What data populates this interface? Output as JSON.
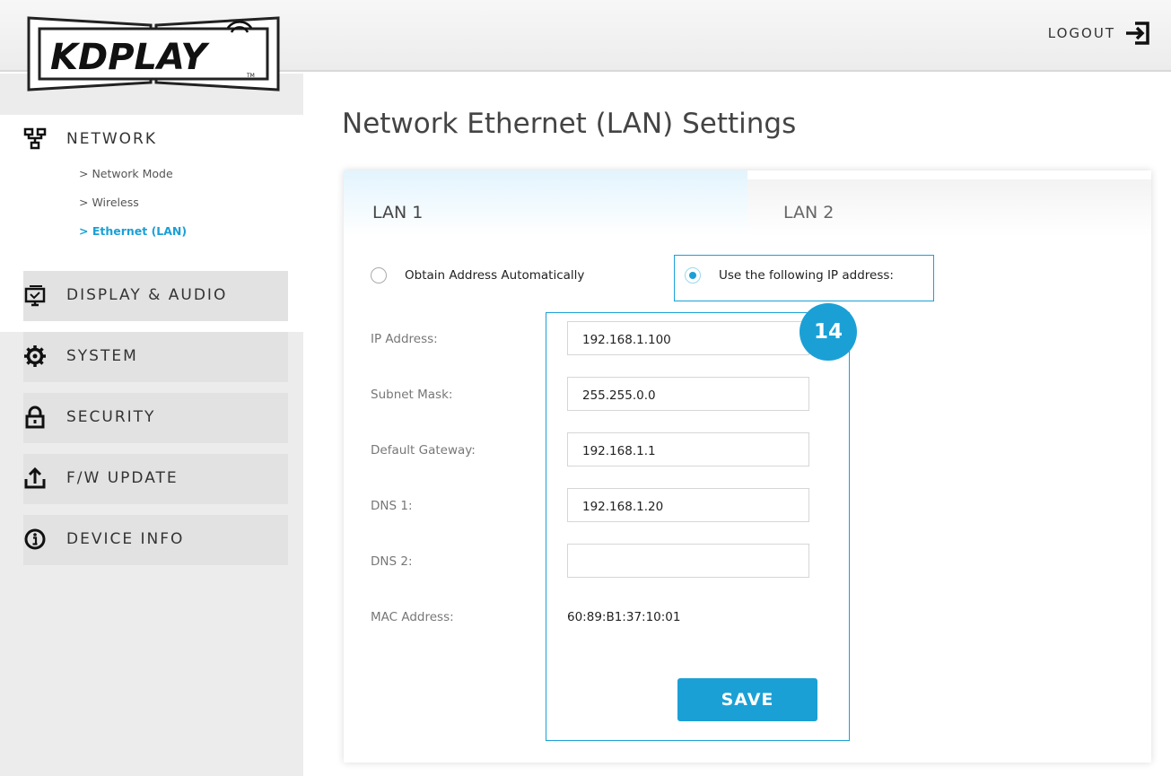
{
  "logo": {
    "text": "KDPLAY",
    "tm": "TM"
  },
  "header": {
    "logout_label": "LOGOUT"
  },
  "sidebar": {
    "network": {
      "label": "NETWORK",
      "sub_items": [
        {
          "label": "> Network Mode"
        },
        {
          "label": "> Wireless"
        },
        {
          "label": "> Ethernet (LAN)"
        }
      ]
    },
    "items": [
      {
        "label": "DISPLAY & AUDIO"
      },
      {
        "label": "SYSTEM"
      },
      {
        "label": "SECURITY"
      },
      {
        "label": "F/W UPDATE"
      },
      {
        "label": "DEVICE INFO"
      }
    ]
  },
  "main": {
    "title": "Network Ethernet (LAN) Settings",
    "tabs": [
      {
        "label": "LAN 1"
      },
      {
        "label": "LAN 2"
      }
    ],
    "mode": {
      "auto_label": "Obtain Address Automatically",
      "manual_label": "Use the following IP address:"
    },
    "fields": {
      "ip": {
        "label": "IP Address:",
        "value": "192.168.1.100"
      },
      "subnet": {
        "label": "Subnet Mask:",
        "value": "255.255.0.0"
      },
      "gateway": {
        "label": "Default Gateway:",
        "value": "192.168.1.1"
      },
      "dns1": {
        "label": "DNS 1:",
        "value": "192.168.1.20"
      },
      "dns2": {
        "label": "DNS 2:",
        "value": ""
      },
      "mac": {
        "label": "MAC Address:",
        "value": "60:89:B1:37:10:01"
      }
    },
    "save_label": "SAVE",
    "callout": "14"
  },
  "colors": {
    "accent": "#1ba0d6",
    "sidebar_bg": "#ececec"
  }
}
